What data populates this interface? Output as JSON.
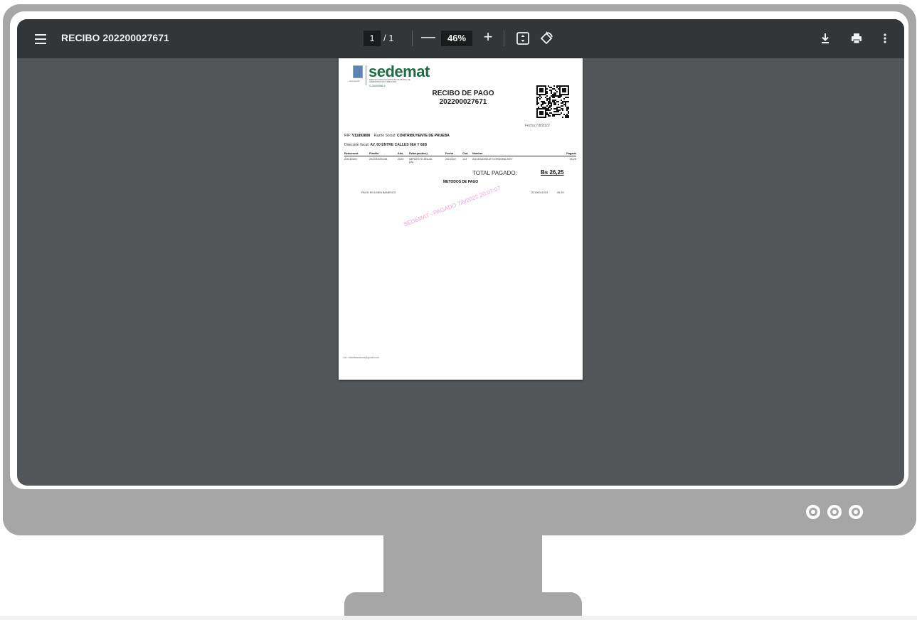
{
  "toolbar": {
    "title": "RECIBO 202200027671",
    "current_page": "1",
    "page_total": "/ 1",
    "zoom_out_label": "—",
    "zoom": "46%",
    "zoom_in_label": "+"
  },
  "document": {
    "brand": "sedemat",
    "brand_subtitle": "SERVICIO DESCONCENTRADO MUNICIPAL DE ADMINISTRACIÓN TRIBUTARIA",
    "brand_rif": "G-20003956-4",
    "logo_caption": "ALCALDÍA",
    "receipt_title": "RECIBO DE PAGO",
    "receipt_number": "202200027671",
    "fecha": "Fecha:7/8/2022",
    "rif_label": "RIF:",
    "rif_value": "V11893808",
    "razon_label": "Razón Social:",
    "razon_value": "CONTRIBUYENTE DE PRUEBA",
    "direccion_label": "Dirección fiscal:",
    "direccion_value": "AV. 60 ENTRE CALLES 68A Y 68B",
    "table": {
      "headers": [
        "Referencia",
        "Planilla",
        "Año",
        "Deber(motivo)",
        "Fecha",
        "Cód.",
        "Nombre",
        "Pagado"
      ],
      "row": [
        "AH445UM",
        "202200000158",
        "2022",
        "IMPUESTO ANUAL (IA)",
        "2/6/2022",
        "113",
        "AH445UMSEAT CORDOBA 2007",
        "26,25"
      ]
    },
    "total_label": "TOTAL PAGADO:",
    "total_value": "Bs 26,25",
    "metodos_title": "METODOS DE PAGO",
    "pago_metodo": "PAGO EN LINEA BANESCO",
    "pago_referencia": "22190011023",
    "pago_monto": "26,25",
    "watermark": "SEDEMAT - PAGADO 7/8/2022 20:07:07",
    "user_footer": "Usr: rafaelescalona@gmail.com"
  },
  "icons": {
    "menu": "menu-icon",
    "fit": "fit-to-page-icon",
    "rotate": "rotate-icon",
    "download": "download-icon",
    "print": "print-icon",
    "more": "more-vertical-icon"
  },
  "colors": {
    "toolbar": "#323639",
    "viewer_bg": "#525659",
    "monitor": "#a6a6a6",
    "brand_green": "#1f6b45",
    "watermark": "#e9a3e4"
  }
}
